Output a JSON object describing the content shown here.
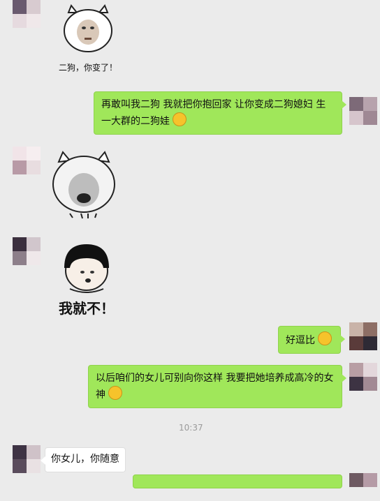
{
  "chat": {
    "messages": [
      {
        "side": "left",
        "type": "sticker",
        "caption": "二狗，你变了！",
        "icon": "pig-face-sticker"
      },
      {
        "side": "right",
        "type": "text",
        "text": "再敢叫我二狗 我就把你抱回家 让你变成二狗媳妇 生一大群的二狗娃",
        "emoji": "tongue-wink-emoji"
      },
      {
        "side": "left",
        "type": "sticker",
        "icon": "blurred-pig-face-sticker"
      },
      {
        "side": "left",
        "type": "sticker",
        "caption": "我就不！",
        "icon": "bowl-cut-face-sticker"
      },
      {
        "side": "right",
        "type": "text",
        "text": "好逗比",
        "emoji": "facepalm-emoji"
      },
      {
        "side": "right",
        "type": "text",
        "text": "以后咱们的女儿可别向你这样 我要把她培养成高冷的女神",
        "emoji": "sunglasses-emoji"
      },
      {
        "type": "timestamp",
        "text": "10:37"
      },
      {
        "side": "left",
        "type": "text",
        "text": "你女儿，你随意"
      }
    ]
  },
  "colors": {
    "background": "#ebebeb",
    "sent_bubble": "#a0e75a",
    "received_bubble": "#ffffff",
    "timestamp": "#9a9a9a"
  }
}
